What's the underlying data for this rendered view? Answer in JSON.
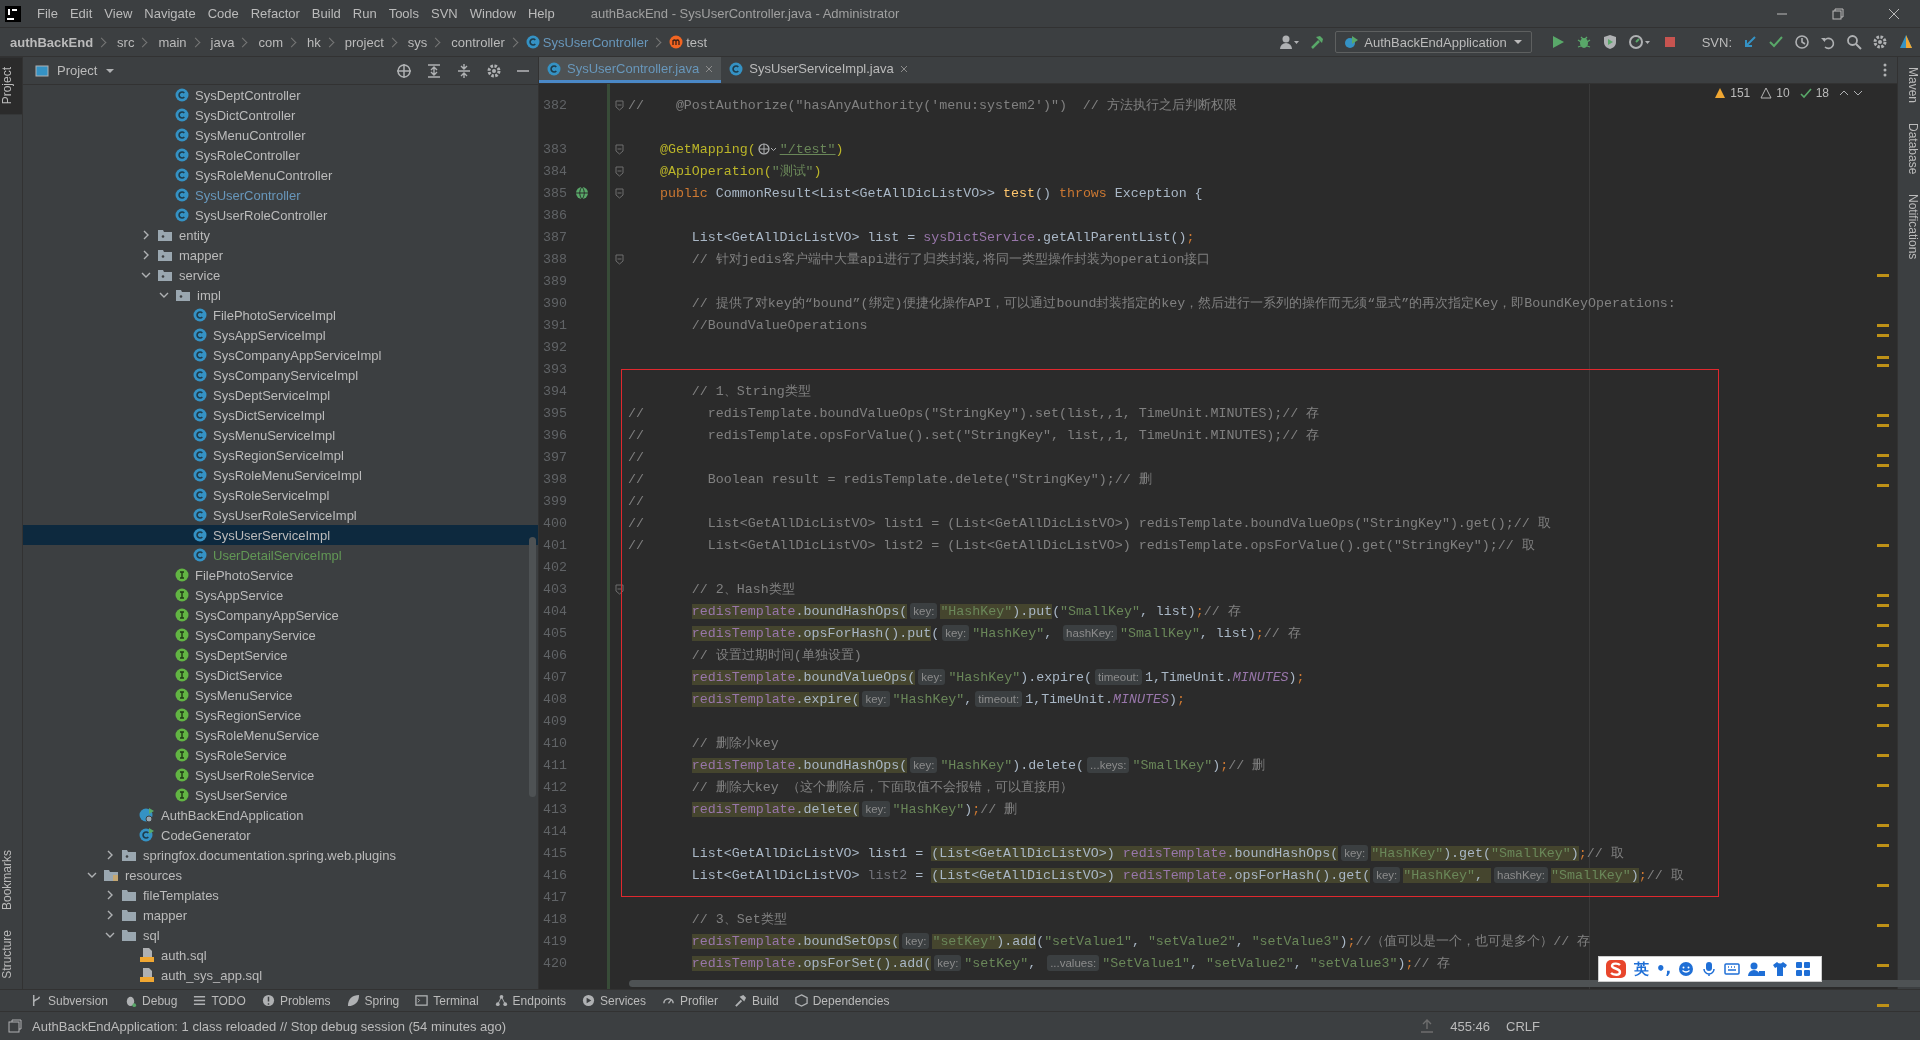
{
  "window": {
    "title": "authBackEnd - SysUserController.java - Administrator"
  },
  "menu": [
    "File",
    "Edit",
    "View",
    "Navigate",
    "Code",
    "Refactor",
    "Build",
    "Run",
    "Tools",
    "SVN",
    "Window",
    "Help"
  ],
  "breadcrumbs": [
    {
      "label": "authBackEnd",
      "kind": "project"
    },
    {
      "label": "src",
      "kind": "folder"
    },
    {
      "label": "main",
      "kind": "folder"
    },
    {
      "label": "java",
      "kind": "folder"
    },
    {
      "label": "com",
      "kind": "folder"
    },
    {
      "label": "hk",
      "kind": "folder"
    },
    {
      "label": "project",
      "kind": "folder"
    },
    {
      "label": "sys",
      "kind": "folder"
    },
    {
      "label": "controller",
      "kind": "folder"
    },
    {
      "label": "SysUserController",
      "kind": "class"
    },
    {
      "label": "test",
      "kind": "method"
    }
  ],
  "run_config": "AuthBackEndApplication",
  "svn_label": "SVN:",
  "left_stripe": [
    {
      "label": "Project",
      "selected": true
    },
    {
      "label": "Bookmarks",
      "selected": false
    },
    {
      "label": "Structure",
      "selected": false
    }
  ],
  "right_stripe": [
    "Maven",
    "Database",
    "Notifications"
  ],
  "project_panel": {
    "title": "Project"
  },
  "tree": [
    {
      "children": [
        {
          "children": [
            {
              "children": [
                {
                  "children": [
                    {
                      "label": "SysDeptController",
                      "kind": "class",
                      "selected": false
                    },
                    {
                      "label": "SysDictController",
                      "kind": "class",
                      "selected": false
                    },
                    {
                      "label": "SysMenuController",
                      "kind": "class",
                      "selected": false
                    },
                    {
                      "label": "SysRoleController",
                      "kind": "class",
                      "selected": false
                    },
                    {
                      "label": "SysRoleMenuController",
                      "kind": "class",
                      "selected": false
                    },
                    {
                      "label": "SysUserController",
                      "kind": "class",
                      "selected": false,
                      "color": "#6897bb"
                    },
                    {
                      "label": "SysUserRoleController",
                      "kind": "class",
                      "selected": false
                    }
                  ]
                },
                {
                  "label": "entity",
                  "kind": "package",
                  "expanded": false,
                  "selected": false
                },
                {
                  "label": "mapper",
                  "kind": "package",
                  "expanded": false,
                  "selected": false
                },
                {
                  "label": "service",
                  "kind": "package",
                  "expanded": true,
                  "selected": false,
                  "children": [
                    {
                      "label": "impl",
                      "kind": "package",
                      "expanded": true,
                      "selected": false,
                      "children": [
                        {
                          "label": "FilePhotoServiceImpl",
                          "kind": "class",
                          "selected": false
                        },
                        {
                          "label": "SysAppServiceImpl",
                          "kind": "class",
                          "selected": false
                        },
                        {
                          "label": "SysCompanyAppServiceImpl",
                          "kind": "class",
                          "selected": false
                        },
                        {
                          "label": "SysCompanyServiceImpl",
                          "kind": "class",
                          "selected": false
                        },
                        {
                          "label": "SysDeptServiceImpl",
                          "kind": "class",
                          "selected": false
                        },
                        {
                          "label": "SysDictServiceImpl",
                          "kind": "class",
                          "selected": false
                        },
                        {
                          "label": "SysMenuServiceImpl",
                          "kind": "class",
                          "selected": false
                        },
                        {
                          "label": "SysRegionServiceImpl",
                          "kind": "class",
                          "selected": false
                        },
                        {
                          "label": "SysRoleMenuServiceImpl",
                          "kind": "class",
                          "selected": false
                        },
                        {
                          "label": "SysRoleServiceImpl",
                          "kind": "class",
                          "selected": false
                        },
                        {
                          "label": "SysUserRoleServiceImpl",
                          "kind": "class",
                          "selected": false
                        },
                        {
                          "label": "SysUserServiceImpl",
                          "kind": "class",
                          "selected": true
                        },
                        {
                          "label": "UserDetailServiceImpl",
                          "kind": "class",
                          "selected": false,
                          "color": "#629755"
                        }
                      ]
                    },
                    {
                      "label": "FilePhotoService",
                      "kind": "interface",
                      "selected": false
                    },
                    {
                      "label": "SysAppService",
                      "kind": "interface",
                      "selected": false
                    },
                    {
                      "label": "SysCompanyAppService",
                      "kind": "interface",
                      "selected": false
                    },
                    {
                      "label": "SysCompanyService",
                      "kind": "interface",
                      "selected": false
                    },
                    {
                      "label": "SysDeptService",
                      "kind": "interface",
                      "selected": false
                    },
                    {
                      "label": "SysDictService",
                      "kind": "interface",
                      "selected": false
                    },
                    {
                      "label": "SysMenuService",
                      "kind": "interface",
                      "selected": false
                    },
                    {
                      "label": "SysRegionService",
                      "kind": "interface",
                      "selected": false
                    },
                    {
                      "label": "SysRoleMenuService",
                      "kind": "interface",
                      "selected": false
                    },
                    {
                      "label": "SysRoleService",
                      "kind": "interface",
                      "selected": false
                    },
                    {
                      "label": "SysUserRoleService",
                      "kind": "interface",
                      "selected": false
                    },
                    {
                      "label": "SysUserService",
                      "kind": "interface",
                      "selected": false
                    }
                  ]
                }
              ]
            },
            {
              "label": "AuthBackEndApplication",
              "kind": "spring-app",
              "selected": false
            },
            {
              "label": "CodeGenerator",
              "kind": "runnable",
              "selected": false
            }
          ]
        },
        {
          "label": "springfox.documentation.spring.web.plugins",
          "kind": "package",
          "expanded": false,
          "selected": false
        }
      ]
    },
    {
      "label": "resources",
      "kind": "resource-folder",
      "expanded": true,
      "selected": false,
      "children": [
        {
          "label": "fileTemplates",
          "kind": "folder",
          "expanded": false,
          "selected": false
        },
        {
          "label": "mapper",
          "kind": "folder",
          "expanded": false,
          "selected": false
        },
        {
          "label": "sql",
          "kind": "folder",
          "expanded": true,
          "selected": false,
          "children": [
            {
              "label": "auth.sql",
              "kind": "sql-file",
              "selected": false
            },
            {
              "label": "auth_sys_app.sql",
              "kind": "sql-file",
              "selected": false
            }
          ]
        }
      ]
    }
  ],
  "editor_tabs": [
    {
      "label": "SysUserController.java",
      "selected": true,
      "modified": true
    },
    {
      "label": "SysUserServiceImpl.java",
      "selected": false,
      "modified": false
    }
  ],
  "inspections": {
    "warnings": "151",
    "weak_warnings": "10",
    "typos": "18"
  },
  "code_lines": [
    {
      "no": "382",
      "fold": true,
      "tokens": [
        {
          "kind": "comment",
          "text": "//    @PostAuthorize(\"hasAnyAuthority('menu:system2')\")  // 方法执行之后判断权限"
        }
      ]
    },
    {
      "no": "383",
      "fold": true,
      "gap_above": true,
      "tokens": [
        {
          "kind": "annotation",
          "text": "    @GetMapping("
        },
        {
          "kind": "url-icon"
        },
        {
          "kind": "link",
          "text": "\"/test\""
        },
        {
          "kind": "annotation",
          "text": ")"
        }
      ]
    },
    {
      "no": "384",
      "fold": true,
      "tokens": [
        {
          "kind": "annotation",
          "text": "    @ApiOperation("
        },
        {
          "kind": "string",
          "text": "\"测试\""
        },
        {
          "kind": "annotation",
          "text": ")"
        }
      ]
    },
    {
      "no": "385",
      "fold": true,
      "endpoint": true,
      "tokens": [
        {
          "kind": "keyword",
          "text": "    public"
        },
        {
          "kind": "plain",
          "text": " CommonResult<List<GetAllDicListVO>> "
        },
        {
          "kind": "method",
          "text": "test"
        },
        {
          "kind": "plain",
          "text": "() "
        },
        {
          "kind": "keyword",
          "text": "throws"
        },
        {
          "kind": "plain",
          "text": " Exception {"
        }
      ]
    },
    {
      "no": "386",
      "fold": false
    },
    {
      "no": "387",
      "fold": false,
      "tokens": [
        {
          "kind": "plain",
          "text": "        List<GetAllDicListVO> list = "
        },
        {
          "kind": "field",
          "text": "sysDictService"
        },
        {
          "kind": "plain",
          "text": ".getAllParentList()"
        },
        {
          "kind": "keyword",
          "text": ";"
        }
      ]
    },
    {
      "no": "388",
      "fold": true,
      "tokens": [
        {
          "kind": "comment",
          "text": "        // 针对jedis客户端中大量api进行了归类封装,将同一类型操作封装为operation接口"
        }
      ]
    },
    {
      "no": "389",
      "fold": false
    },
    {
      "no": "390",
      "fold": false,
      "tokens": [
        {
          "kind": "comment",
          "text": "        // 提供了对key的“bound”(绑定)便捷化操作API，可以通过bound封装指定的key，然后进行一系列的操作而无须“显式”的再次指定Key，即BoundKeyOperations:"
        }
      ]
    },
    {
      "no": "391",
      "fold": false,
      "tokens": [
        {
          "kind": "comment",
          "text": "        //BoundValueOperations"
        }
      ]
    },
    {
      "no": "392",
      "fold": false
    },
    {
      "no": "393",
      "fold": false
    },
    {
      "no": "394",
      "fold": false,
      "tokens": [
        {
          "kind": "comment",
          "text": "        // 1、String类型"
        }
      ]
    },
    {
      "no": "395",
      "fold": false,
      "tokens": [
        {
          "kind": "comment",
          "text": "//        redisTemplate.boundValueOps(\"StringKey\").set(list,,1, TimeUnit.MINUTES);// 存"
        }
      ]
    },
    {
      "no": "396",
      "fold": false,
      "tokens": [
        {
          "kind": "comment",
          "text": "//        redisTemplate.opsForValue().set(\"StringKey\", list,,1, TimeUnit.MINUTES);// 存"
        }
      ]
    },
    {
      "no": "397",
      "fold": false,
      "tokens": [
        {
          "kind": "comment",
          "text": "//"
        }
      ]
    },
    {
      "no": "398",
      "fold": false,
      "tokens": [
        {
          "kind": "comment",
          "text": "//        Boolean result = redisTemplate.delete(\"StringKey\");// 删"
        }
      ]
    },
    {
      "no": "399",
      "fold": false,
      "tokens": [
        {
          "kind": "comment",
          "text": "//"
        }
      ]
    },
    {
      "no": "400",
      "fold": false,
      "tokens": [
        {
          "kind": "comment",
          "text": "//        List<GetAllDicListVO> list1 = (List<GetAllDicListVO>) redisTemplate.boundValueOps(\"StringKey\").get();// 取"
        }
      ]
    },
    {
      "no": "401",
      "fold": false,
      "tokens": [
        {
          "kind": "comment",
          "text": "//        List<GetAllDicListVO> list2 = (List<GetAllDicListVO>) redisTemplate.opsForValue().get(\"StringKey\");// 取"
        }
      ]
    },
    {
      "no": "402",
      "fold": false
    },
    {
      "no": "403",
      "fold": true,
      "tokens": [
        {
          "kind": "comment",
          "text": "        // 2、Hash类型"
        }
      ]
    },
    {
      "no": "404",
      "fold": false,
      "tokens": [
        {
          "kind": "field-hl",
          "text": "        redisTemplate"
        },
        {
          "kind": "plain-hl",
          "text": ".boundHashOps("
        },
        {
          "kind": "hint",
          "text": "key:"
        },
        {
          "kind": "string-hl",
          "text": "\"HashKey\""
        },
        {
          "kind": "plain-hl",
          "text": ").put"
        },
        {
          "kind": "plain",
          "text": "("
        },
        {
          "kind": "string",
          "text": "\"SmallKey\""
        },
        {
          "kind": "plain",
          "text": ", list)"
        },
        {
          "kind": "keyword",
          "text": ";"
        },
        {
          "kind": "comment",
          "text": "// 存"
        }
      ]
    },
    {
      "no": "405",
      "fold": false,
      "tokens": [
        {
          "kind": "field-hl",
          "text": "        redisTemplate"
        },
        {
          "kind": "plain-hl",
          "text": ".opsForHash().put"
        },
        {
          "kind": "plain",
          "text": "("
        },
        {
          "kind": "hint",
          "text": "key:"
        },
        {
          "kind": "string",
          "text": "\"HashKey\""
        },
        {
          "kind": "plain",
          "text": ", "
        },
        {
          "kind": "hint",
          "text": "hashKey:"
        },
        {
          "kind": "string",
          "text": "\"SmallKey\""
        },
        {
          "kind": "plain",
          "text": ", list)"
        },
        {
          "kind": "keyword",
          "text": ";"
        },
        {
          "kind": "comment",
          "text": "// 存"
        }
      ]
    },
    {
      "no": "406",
      "fold": false,
      "tokens": [
        {
          "kind": "comment",
          "text": "        // 设置过期时间(单独设置)"
        }
      ]
    },
    {
      "no": "407",
      "fold": false,
      "tokens": [
        {
          "kind": "field-hl",
          "text": "        redisTemplate"
        },
        {
          "kind": "plain-hl",
          "text": ".boundValueOps("
        },
        {
          "kind": "hint",
          "text": "key:"
        },
        {
          "kind": "string",
          "text": "\"HashKey\""
        },
        {
          "kind": "plain",
          "text": ").expire("
        },
        {
          "kind": "hint",
          "text": "timeout:"
        },
        {
          "kind": "plain",
          "text": "1,TimeUnit."
        },
        {
          "kind": "const",
          "text": "MINUTES"
        },
        {
          "kind": "plain",
          "text": ")"
        },
        {
          "kind": "keyword",
          "text": ";"
        }
      ]
    },
    {
      "no": "408",
      "fold": false,
      "tokens": [
        {
          "kind": "field-hl",
          "text": "        redisTemplate"
        },
        {
          "kind": "plain-hl",
          "text": ".expire("
        },
        {
          "kind": "hint",
          "text": "key:"
        },
        {
          "kind": "string",
          "text": "\"HashKey\""
        },
        {
          "kind": "plain",
          "text": ","
        },
        {
          "kind": "hint",
          "text": "timeout:"
        },
        {
          "kind": "plain",
          "text": "1,TimeUnit."
        },
        {
          "kind": "const",
          "text": "MINUTES"
        },
        {
          "kind": "plain",
          "text": ")"
        },
        {
          "kind": "keyword",
          "text": ";"
        }
      ]
    },
    {
      "no": "409",
      "fold": false
    },
    {
      "no": "410",
      "fold": false,
      "tokens": [
        {
          "kind": "comment",
          "text": "        // 删除小key"
        }
      ]
    },
    {
      "no": "411",
      "fold": false,
      "tokens": [
        {
          "kind": "field-hl",
          "text": "        redisTemplate"
        },
        {
          "kind": "plain-hl",
          "text": ".boundHashOps("
        },
        {
          "kind": "hint",
          "text": "key:"
        },
        {
          "kind": "string",
          "text": "\"HashKey\""
        },
        {
          "kind": "plain",
          "text": ").delete("
        },
        {
          "kind": "hint",
          "text": "...keys:"
        },
        {
          "kind": "string",
          "text": "\"SmallKey\""
        },
        {
          "kind": "plain",
          "text": ")"
        },
        {
          "kind": "keyword",
          "text": ";"
        },
        {
          "kind": "comment",
          "text": "// 删"
        }
      ]
    },
    {
      "no": "412",
      "fold": false,
      "tokens": [
        {
          "kind": "comment",
          "text": "        // 删除大key （这个删除后，下面取值不会报错，可以直接用）"
        }
      ]
    },
    {
      "no": "413",
      "fold": false,
      "tokens": [
        {
          "kind": "field-hl",
          "text": "        redisTemplate"
        },
        {
          "kind": "plain-hl",
          "text": ".delete("
        },
        {
          "kind": "hint",
          "text": "key:"
        },
        {
          "kind": "string",
          "text": "\"HashKey\""
        },
        {
          "kind": "plain",
          "text": ")"
        },
        {
          "kind": "keyword",
          "text": ";"
        },
        {
          "kind": "comment",
          "text": "// 删"
        }
      ]
    },
    {
      "no": "414",
      "fold": false
    },
    {
      "no": "415",
      "fold": false,
      "tokens": [
        {
          "kind": "plain",
          "text": "        List<GetAllDicListVO> list1 = "
        },
        {
          "kind": "plain-hl",
          "text": "(List<GetAllDicListVO>) "
        },
        {
          "kind": "field-hl",
          "text": "redisTemplate"
        },
        {
          "kind": "plain-hl",
          "text": ".boundHashOps("
        },
        {
          "kind": "hint",
          "text": "key:"
        },
        {
          "kind": "string-hl",
          "text": "\"HashKey\""
        },
        {
          "kind": "plain-hl",
          "text": ").get("
        },
        {
          "kind": "string-hl",
          "text": "\"SmallKey\""
        },
        {
          "kind": "plain-hl",
          "text": ")"
        },
        {
          "kind": "keyword",
          "text": ";"
        },
        {
          "kind": "comment",
          "text": "// 取"
        }
      ]
    },
    {
      "no": "416",
      "fold": false,
      "tokens": [
        {
          "kind": "plain",
          "text": "        List<GetAllDicListVO> "
        },
        {
          "kind": "unused",
          "text": "list2"
        },
        {
          "kind": "plain",
          "text": " = "
        },
        {
          "kind": "plain-hl",
          "text": "(List<GetAllDicListVO>) "
        },
        {
          "kind": "field-hl",
          "text": "redisTemplate"
        },
        {
          "kind": "plain-hl",
          "text": ".opsForHash().get("
        },
        {
          "kind": "hint",
          "text": "key:"
        },
        {
          "kind": "string-hl",
          "text": "\"HashKey\""
        },
        {
          "kind": "plain-hl",
          "text": ", "
        },
        {
          "kind": "hint",
          "text": "hashKey:"
        },
        {
          "kind": "string-hl",
          "text": "\"SmallKey\""
        },
        {
          "kind": "plain-hl",
          "text": ")"
        },
        {
          "kind": "keyword",
          "text": ";"
        },
        {
          "kind": "comment",
          "text": "// 取"
        }
      ]
    },
    {
      "no": "417",
      "fold": false
    },
    {
      "no": "418",
      "fold": false,
      "tokens": [
        {
          "kind": "comment",
          "text": "        // 3、Set类型"
        }
      ]
    },
    {
      "no": "419",
      "fold": false,
      "tokens": [
        {
          "kind": "field-hl",
          "text": "        redisTemplate"
        },
        {
          "kind": "plain-hl",
          "text": ".boundSetOps("
        },
        {
          "kind": "hint",
          "text": "key:"
        },
        {
          "kind": "string-hl",
          "text": "\"setKey\""
        },
        {
          "kind": "plain-hl",
          "text": ").add"
        },
        {
          "kind": "plain",
          "text": "("
        },
        {
          "kind": "string",
          "text": "\"setValue1\""
        },
        {
          "kind": "plain",
          "text": ", "
        },
        {
          "kind": "string",
          "text": "\"setValue2\""
        },
        {
          "kind": "plain",
          "text": ", "
        },
        {
          "kind": "string",
          "text": "\"setValue3\""
        },
        {
          "kind": "plain",
          "text": ")"
        },
        {
          "kind": "keyword",
          "text": ";"
        },
        {
          "kind": "comment",
          "text": "//（值可以是一个，也可是多个）// 存"
        }
      ]
    },
    {
      "no": "420",
      "fold": false,
      "tokens": [
        {
          "kind": "field-hl",
          "text": "        redisTemplate"
        },
        {
          "kind": "plain-hl",
          "text": ".opsForSet().add("
        },
        {
          "kind": "hint",
          "text": "key:"
        },
        {
          "kind": "string",
          "text": "\"setKey\""
        },
        {
          "kind": "plain",
          "text": ", "
        },
        {
          "kind": "hint",
          "text": "...values:"
        },
        {
          "kind": "string",
          "text": "\"SetValue1\""
        },
        {
          "kind": "plain",
          "text": ", "
        },
        {
          "kind": "string",
          "text": "\"setValue2\""
        },
        {
          "kind": "plain",
          "text": ", "
        },
        {
          "kind": "string",
          "text": "\"setValue3\""
        },
        {
          "kind": "plain",
          "text": ")"
        },
        {
          "kind": "keyword",
          "text": ";"
        },
        {
          "kind": "comment",
          "text": "// 存"
        }
      ]
    }
  ],
  "tool_windows": [
    "Subversion",
    "Debug",
    "TODO",
    "Problems",
    "Spring",
    "Terminal",
    "Endpoints",
    "Services",
    "Profiler",
    "Build",
    "Dependencies"
  ],
  "status_bar": {
    "message": "AuthBackEndApplication: 1 class reloaded // Stop debug session (54 minutes ago)",
    "position": "455:46",
    "line_separator": "CRLF"
  },
  "ime_bar": {
    "mode": "英",
    "punctuation": "•,"
  }
}
